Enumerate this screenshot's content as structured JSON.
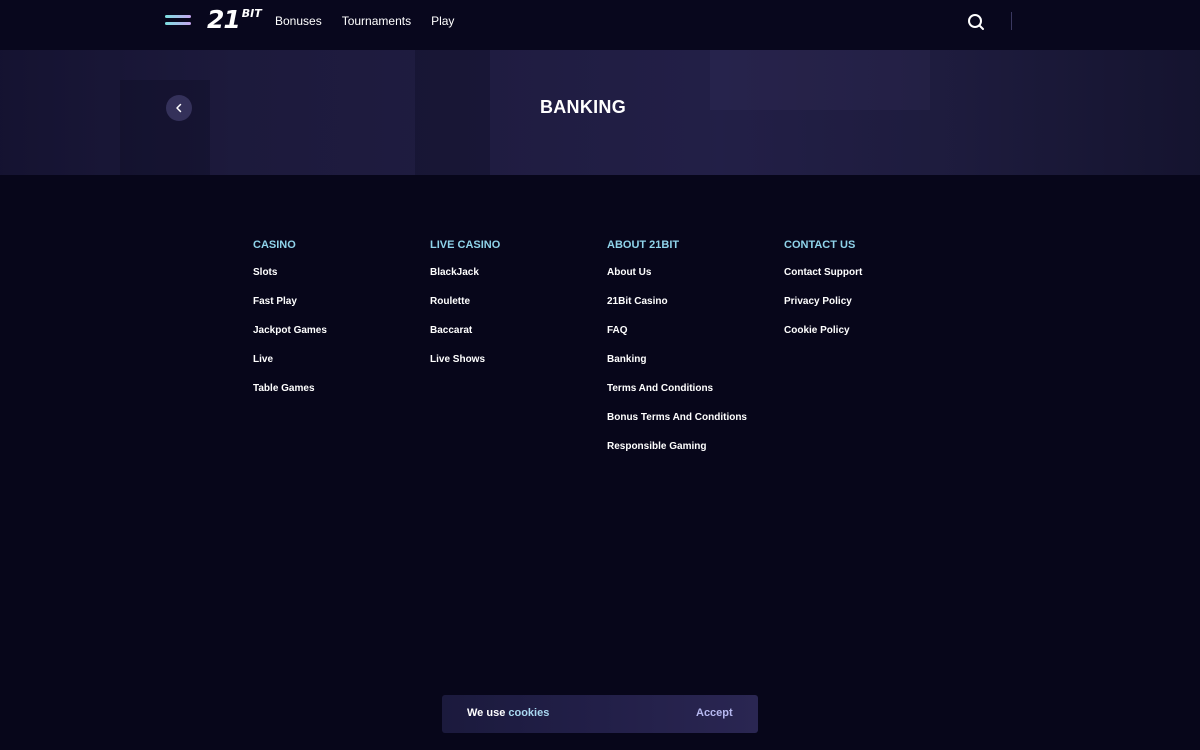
{
  "header": {
    "logo_number": "21",
    "logo_suffix": "BIT",
    "nav": [
      "Bonuses",
      "Tournaments",
      "Play"
    ]
  },
  "hero": {
    "title": "BANKING"
  },
  "footer": {
    "columns": [
      {
        "heading": "CASINO",
        "links": [
          "Slots",
          "Fast Play",
          "Jackpot Games",
          "Live",
          "Table Games"
        ]
      },
      {
        "heading": "LIVE CASINO",
        "links": [
          "BlackJack",
          "Roulette",
          "Baccarat",
          "Live Shows"
        ]
      },
      {
        "heading": "ABOUT 21BIT",
        "links": [
          "About Us",
          "21Bit Casino",
          "FAQ",
          "Banking",
          "Terms And Conditions",
          "Bonus Terms And Conditions",
          "Responsible Gaming"
        ]
      },
      {
        "heading": "CONTACT US",
        "links": [
          "Contact Support",
          "Privacy Policy",
          "Cookie Policy"
        ]
      }
    ]
  },
  "cookie_banner": {
    "text": "We use",
    "link": "cookies",
    "accept_label": "Accept"
  },
  "icons": {
    "menu": "hamburger-menu-icon",
    "search": "search-icon",
    "back": "chevron-left-icon"
  },
  "colors": {
    "background": "#07061a",
    "accent_cyan": "#8fd3ea",
    "accent_purple": "#b6b8f0"
  }
}
